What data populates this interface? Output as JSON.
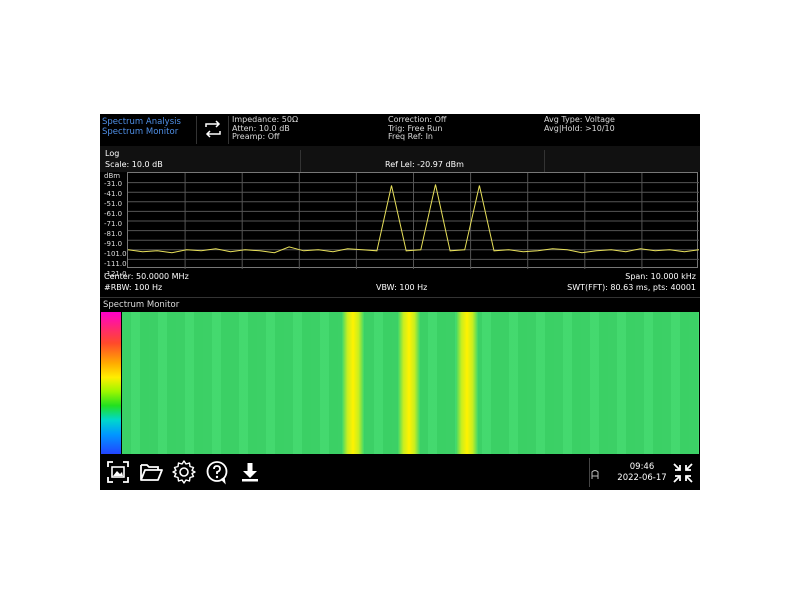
{
  "header": {
    "mode_line1": "Spectrum Analysis",
    "mode_line2": "Spectrum Monitor",
    "impedance": "Impedance: 50Ω",
    "atten": "Atten: 10.0 dB",
    "preamp": "Preamp: Off",
    "correction": "Correction: Off",
    "trig": "Trig: Free Run",
    "freq_ref": "Freq Ref: In",
    "avg_type": "Avg Type: Voltage",
    "avg_hold": "Avg|Hold: >10/10"
  },
  "trace_info": {
    "mode": "Log",
    "scale": "Scale: 10.0 dB",
    "ref_level": "Ref Lel: -20.97 dBm"
  },
  "plot": {
    "unit": "dBm",
    "y_labels": [
      "-31.0",
      "-41.0",
      "-51.0",
      "-61.0",
      "-71.0",
      "-81.0",
      "-91.0",
      "-101.0",
      "-111.0",
      "-121.0"
    ],
    "trace_color": "#e8e05a"
  },
  "params": {
    "center": "Center: 50.0000 MHz",
    "rbw": "#RBW: 100 Hz",
    "vbw": "VBW: 100 Hz",
    "span": "Span: 10.000 kHz",
    "swt": "SWT(FFT): 80.63 ms, pts: 40001"
  },
  "waterfall": {
    "title": "Spectrum Monitor"
  },
  "toolbar": {
    "buttons": [
      "screenshot-icon",
      "folder-icon",
      "gear-icon",
      "help-icon",
      "download-icon"
    ],
    "time": "09:46",
    "date": "2022-06-17"
  },
  "chart_data": {
    "type": "line",
    "xlabel": "",
    "ylabel": "dBm",
    "ylim": [
      -121,
      -21
    ],
    "series": [
      {
        "values": [
          -101,
          -103,
          -102,
          -104,
          -101,
          -102,
          -100,
          -103,
          -101,
          -102,
          -104,
          -98,
          -102,
          -101,
          -103,
          -100,
          -101,
          -102,
          -34,
          -102,
          -101,
          -33,
          -102,
          -101,
          -34,
          -102,
          -101,
          -103,
          -102,
          -100,
          -101,
          -104,
          -102,
          -101,
          -103,
          -100,
          -102,
          -101,
          -103,
          -101
        ]
      }
    ]
  }
}
